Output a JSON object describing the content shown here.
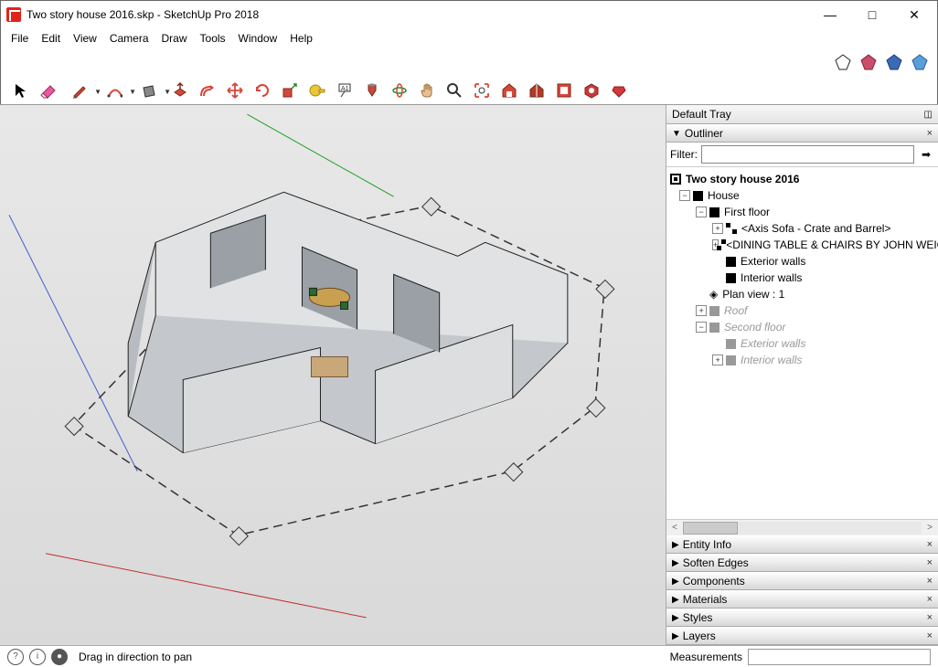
{
  "title": "Two story house 2016.skp - SketchUp Pro 2018",
  "menu": [
    "File",
    "Edit",
    "View",
    "Camera",
    "Draw",
    "Tools",
    "Window",
    "Help"
  ],
  "tray": {
    "title": "Default Tray",
    "outliner": {
      "label": "Outliner",
      "filter_label": "Filter:",
      "filter_value": "",
      "root": "Two story house 2016",
      "house": "House",
      "first_floor": "First floor",
      "sofa": "<Axis Sofa - Crate and Barrel>",
      "dining": "<DINING TABLE & CHAIRS BY JOHN WEICK",
      "ext_walls": "Exterior walls",
      "int_walls": "Interior walls",
      "plan_view": "Plan view : 1",
      "roof": "Roof",
      "second_floor": "Second floor",
      "ext_walls2": "Exterior walls",
      "int_walls2": "Interior walls"
    },
    "panels": [
      "Entity Info",
      "Soften Edges",
      "Components",
      "Materials",
      "Styles",
      "Layers"
    ]
  },
  "status": {
    "hint": "Drag in direction to pan",
    "meas": "Measurements"
  }
}
